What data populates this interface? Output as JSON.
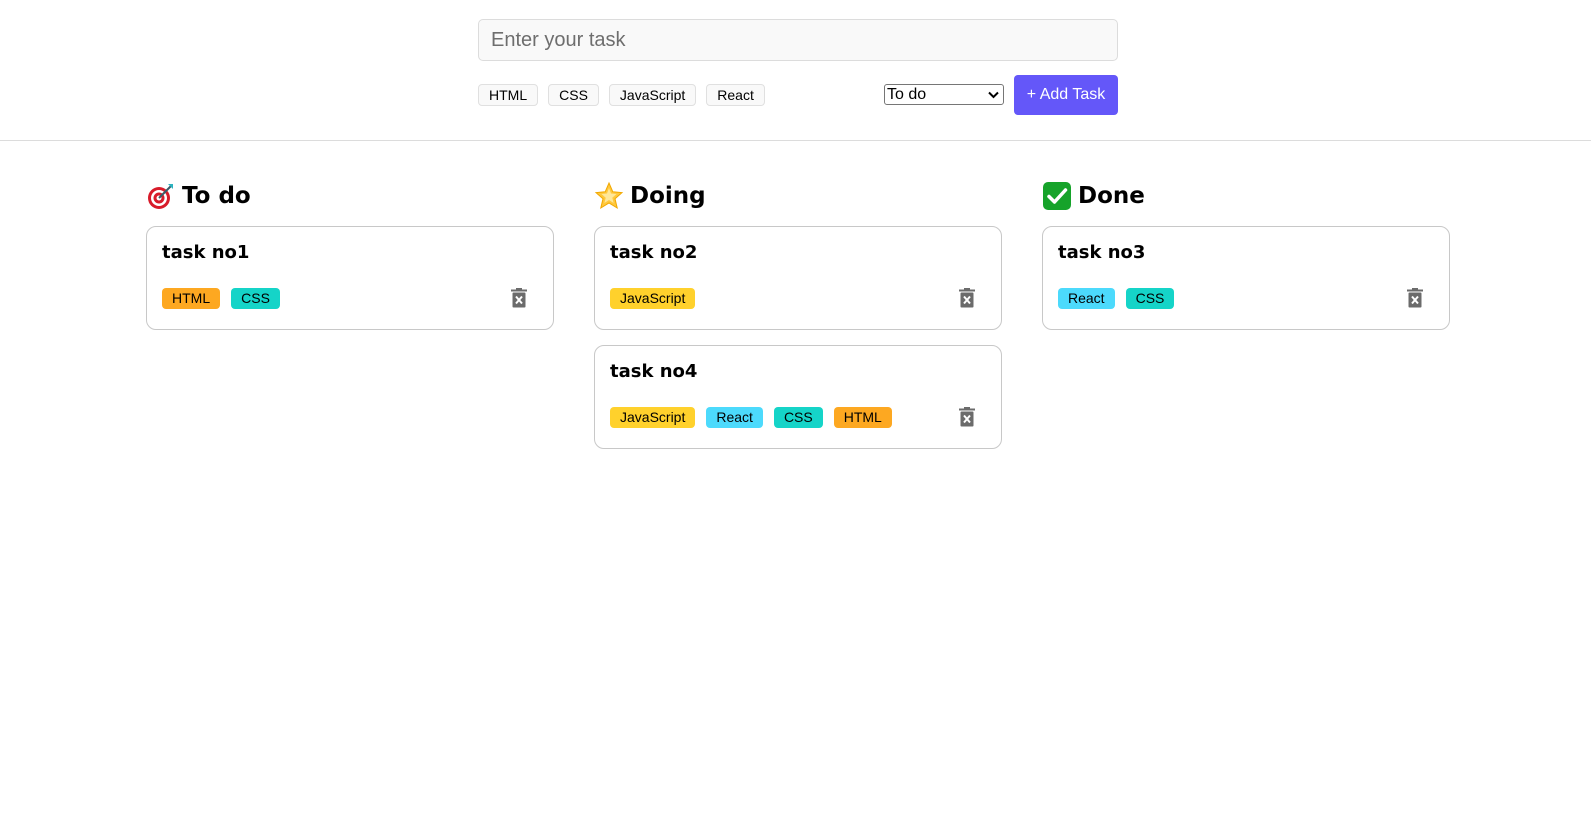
{
  "header": {
    "input_placeholder": "Enter your task",
    "tag_options": [
      "HTML",
      "CSS",
      "JavaScript",
      "React"
    ],
    "status_selected": "To do",
    "add_button_label": "+ Add Task"
  },
  "colors": {
    "HTML": "#fda821",
    "CSS": "#15d4c8",
    "JavaScript": "#ffd12c",
    "React": "#4cdafc",
    "accent": "#6457f9"
  },
  "columns": [
    {
      "title": "To do",
      "icon": "target-dart-icon",
      "cards": [
        {
          "title": "task no1",
          "tags": [
            "HTML",
            "CSS"
          ]
        }
      ]
    },
    {
      "title": "Doing",
      "icon": "glowing-star-icon",
      "cards": [
        {
          "title": "task no2",
          "tags": [
            "JavaScript"
          ]
        },
        {
          "title": "task no4",
          "tags": [
            "JavaScript",
            "React",
            "CSS",
            "HTML"
          ]
        }
      ]
    },
    {
      "title": "Done",
      "icon": "check-mark-icon",
      "cards": [
        {
          "title": "task no3",
          "tags": [
            "React",
            "CSS"
          ]
        }
      ]
    }
  ]
}
